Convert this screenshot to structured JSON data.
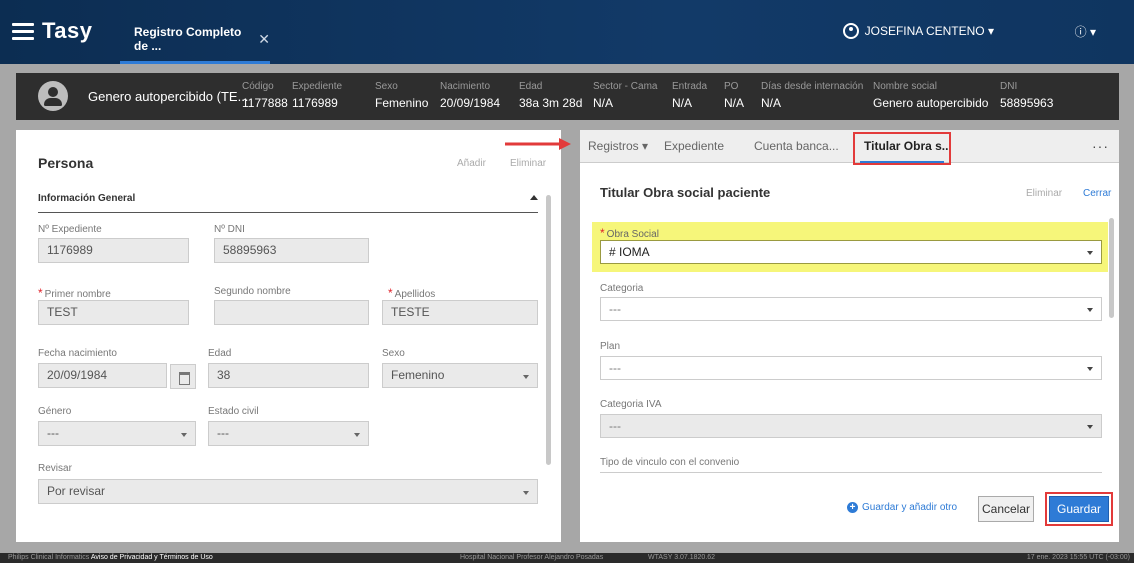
{
  "header": {
    "brand": "Tasy",
    "app_tab": "Registro Completo de ...",
    "app_tab_close": "✕",
    "user": "JOSEFINA CENTENO ▾",
    "info": "ⓘ ▾"
  },
  "patient": {
    "name": "Genero autopercibido (TE...",
    "fields": [
      {
        "label": "Código",
        "value": "1177888"
      },
      {
        "label": "Expediente",
        "value": "1176989"
      },
      {
        "label": "Sexo",
        "value": "Femenino"
      },
      {
        "label": "Nacimiento",
        "value": "20/09/1984"
      },
      {
        "label": "Edad",
        "value": "38a 3m 28d"
      },
      {
        "label": "Sector - Cama",
        "value": "N/A"
      },
      {
        "label": "Entrada",
        "value": "N/A"
      },
      {
        "label": "PO",
        "value": "N/A"
      },
      {
        "label": "Días desde internación",
        "value": "N/A"
      },
      {
        "label": "Nombre social",
        "value": "Genero autopercibido"
      },
      {
        "label": "DNI",
        "value": "58895963"
      }
    ]
  },
  "persona": {
    "title": "Persona",
    "add": "Añadir",
    "delete": "Eliminar",
    "section": "Información General",
    "expediente_label": "Nº Expediente",
    "expediente": "1176989",
    "dni_label": "Nº DNI",
    "dni": "58895963",
    "primer_label": "Primer nombre",
    "primer": "TEST",
    "segundo_label": "Segundo nombre",
    "segundo": "",
    "apellidos_label": "Apellidos",
    "apellidos": "TESTE",
    "fecha_label": "Fecha nacimiento",
    "fecha": "20/09/1984",
    "edad_label": "Edad",
    "edad": "38",
    "sexo_label": "Sexo",
    "sexo": "Femenino",
    "genero_label": "Género",
    "genero": "---",
    "estado_label": "Estado civil",
    "estado": "---",
    "revisar_label": "Revisar",
    "revisar": "Por revisar"
  },
  "tabs": {
    "registros": "Registros ▾",
    "expediente": "Expediente",
    "cuenta": "Cuenta banca...",
    "titular": "Titular Obra s...",
    "more": "···"
  },
  "titular": {
    "title": "Titular Obra social paciente",
    "delete": "Eliminar",
    "close": "Cerrar",
    "obra_label": "Obra Social",
    "obra": "# IOMA",
    "categoria_label": "Categoria",
    "categoria": "---",
    "plan_label": "Plan",
    "plan": "---",
    "iva_label": "Categoria IVA",
    "iva": "---",
    "vinculo_label": "Tipo de vinculo con el convenio",
    "add_other": "Guardar y añadir otro",
    "cancel": "Cancelar",
    "save": "Guardar"
  },
  "footer": {
    "left": "Philips Clinical Informatics",
    "privacy": "Aviso de Privacidad y Términos de Uso",
    "hospital": "Hospital Nacional Profesor Alejandro Posadas",
    "version": "WTASY 3.07.1820.62",
    "datetime": "17 ene. 2023 15:55 UTC (-03:00)"
  },
  "colors": {
    "accent": "#2e7bd6",
    "highlight": "#f6f67a",
    "marker": "#e23a3a",
    "header": "#0c2d52"
  }
}
